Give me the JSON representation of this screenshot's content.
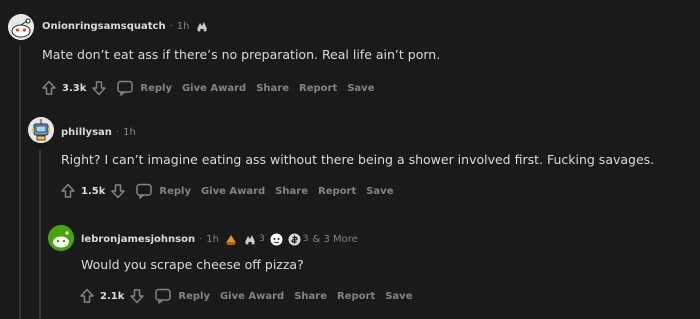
{
  "comments": [
    {
      "username": "Onionringsamsquatch",
      "time": "1h",
      "body": "Mate don’t eat ass if there’s no preparation. Real life ain’t porn.",
      "score": "3.3k"
    },
    {
      "username": "phillysan",
      "time": "1h",
      "body": "Right? I can’t imagine eating ass without there being a shower involved first. Fucking savages.",
      "score": "1.5k"
    },
    {
      "username": "lebronjamesjohnson",
      "time": "1h",
      "body": "Would you scrape cheese off pizza?",
      "score": "2.1k",
      "awards": {
        "count_a": "3",
        "count_b": "3",
        "more": "& 3 More"
      }
    }
  ],
  "actions": {
    "reply": "Reply",
    "give_award": "Give Award",
    "share": "Share",
    "report": "Report",
    "save": "Save"
  },
  "separator": "·",
  "icons": [
    "upvote-icon",
    "downvote-icon",
    "reply-icon",
    "avatar-icon",
    "award-icon"
  ],
  "colors": {
    "background": "#1a1a1b",
    "text": "#d7dadc",
    "muted": "#818384",
    "thread_line": "#343536"
  }
}
